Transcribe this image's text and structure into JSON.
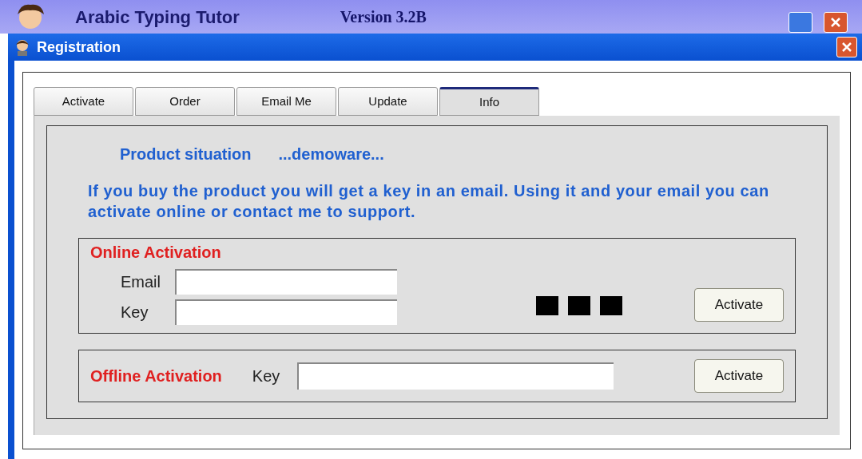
{
  "app_window": {
    "title": "Arabic Typing Tutor",
    "version": "Version 3.2B"
  },
  "dialog": {
    "title": "Registration"
  },
  "tabs": [
    {
      "label": "Activate",
      "selected": false
    },
    {
      "label": "Order",
      "selected": false
    },
    {
      "label": "Email Me",
      "selected": false
    },
    {
      "label": "Update",
      "selected": false
    },
    {
      "label": "Info",
      "selected": true
    }
  ],
  "product_situation": {
    "label": "Product situation",
    "value": "...demoware..."
  },
  "info_text": "If you buy the product you will get a key in an email. Using it and your email you can activate online or contact me to support.",
  "online_activation": {
    "title": "Online Activation",
    "fields": [
      {
        "label": "Email"
      },
      {
        "label": "Key"
      }
    ],
    "button": "Activate"
  },
  "offline_activation": {
    "title": "Offline Activation",
    "field_label": "Key",
    "button": "Activate"
  }
}
